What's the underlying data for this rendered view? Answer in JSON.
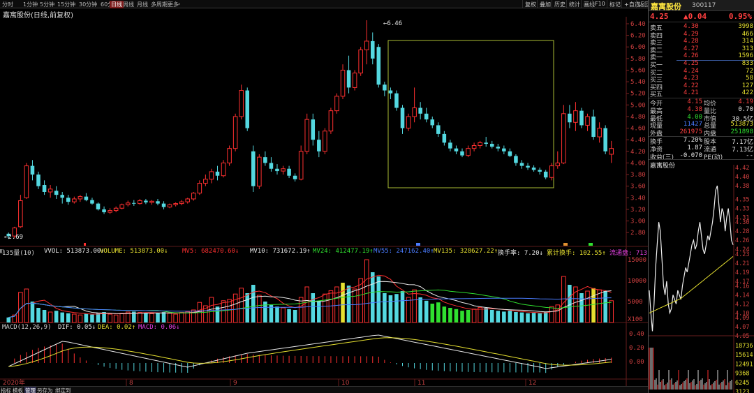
{
  "topbar": {
    "periods": [
      "分时",
      "1分钟",
      "5分钟",
      "15分钟",
      "30分钟",
      "60分钟",
      "日线",
      "周线",
      "月线",
      "多周期",
      "更多"
    ],
    "active_period": "日线",
    "right_tools": [
      "复权",
      "叠加",
      "历史",
      "统计",
      "画线",
      "F10",
      "标记",
      "+自选",
      "返回"
    ]
  },
  "chart": {
    "title": "嘉寓股份(日线,前复权)",
    "high_label": "6.46",
    "low_label": "2.69",
    "price_ticks": [
      "6.40",
      "6.20",
      "6.00",
      "5.80",
      "5.60",
      "5.40",
      "5.20",
      "5.00",
      "4.80",
      "4.60",
      "4.40",
      "4.20",
      "4.00",
      "3.80",
      "3.60",
      "3.40",
      "3.20",
      "3.00",
      "2.80"
    ],
    "month_labels": [
      "2020年",
      "8",
      "9",
      "10",
      "11",
      "12"
    ],
    "vol_header": [
      {
        "text": "135量(10)",
        "color": "#d0d0d0"
      },
      {
        "text": "VVOL: 513873.00↑",
        "color": "#e8e8e8"
      },
      {
        "text": "VOLUME: 513873.00↓",
        "color": "#e6e030"
      },
      {
        "text": "MV5: 682470.60↓",
        "color": "#ff3030"
      },
      {
        "text": "MV10: 731672.19↑",
        "color": "#e8e8e8"
      },
      {
        "text": "MV24: 412477.19↑",
        "color": "#30e030"
      },
      {
        "text": "MV55: 247162.40↑",
        "color": "#4a7cff"
      },
      {
        "text": "MV135: 328627.22↑",
        "color": "#e6e030"
      },
      {
        "text": "换手率: 7.20↓",
        "color": "#e8e8e8"
      },
      {
        "text": "累计换手: 102.55↑",
        "color": "#e6e030"
      },
      {
        "text": "流通盘: 713",
        "color": "#e040e0"
      }
    ],
    "vol_ticks": [
      "15000",
      "10000",
      "5000",
      "X100"
    ],
    "macd_header": [
      {
        "text": "MACD(12,26,9)",
        "color": "#d0d0d0"
      },
      {
        "text": "DIF: 0.05↓",
        "color": "#e8e8e8"
      },
      {
        "text": "DEA: 0.02↑",
        "color": "#e6e030"
      },
      {
        "text": "MACD: 0.06↓",
        "color": "#e040e0"
      }
    ],
    "macd_ticks": [
      "0.40",
      "0.20",
      "0.00"
    ]
  },
  "bottom_tabs": [
    "指标",
    "模板",
    "管理",
    "另存为",
    "绑定到"
  ],
  "quote": {
    "name": "嘉寓股份",
    "code": "300117",
    "price": "4.25",
    "change": "▲0.04",
    "change_pct": "0.95%",
    "asks": [
      {
        "label": "卖五",
        "price": "4.30",
        "vol": "3998"
      },
      {
        "label": "卖四",
        "price": "4.29",
        "vol": "466"
      },
      {
        "label": "卖三",
        "price": "4.28",
        "vol": "314"
      },
      {
        "label": "卖二",
        "price": "4.27",
        "vol": "313"
      },
      {
        "label": "卖一",
        "price": "4.26",
        "vol": "1596"
      }
    ],
    "bids": [
      {
        "label": "买一",
        "price": "4.25",
        "vol": "833"
      },
      {
        "label": "买二",
        "price": "4.24",
        "vol": "72"
      },
      {
        "label": "买三",
        "price": "4.23",
        "vol": "58"
      },
      {
        "label": "买四",
        "price": "4.22",
        "vol": "127"
      },
      {
        "label": "买五",
        "price": "4.21",
        "vol": "422"
      }
    ],
    "stats": [
      {
        "l1": "今开",
        "v1": "4.15",
        "c1": "#ff4040",
        "l2": "均价",
        "v2": "4.19",
        "c2": "#ff4040"
      },
      {
        "l1": "最高",
        "v1": "4.38",
        "c1": "#ff4040",
        "l2": "量比",
        "v2": "0.70",
        "c2": "#e8e8e8"
      },
      {
        "l1": "最低",
        "v1": "4.00",
        "c1": "#30e030",
        "l2": "市值",
        "v2": "30.5亿",
        "c2": "#e8e8e8"
      },
      {
        "l1": "现量",
        "v1": "11427",
        "c1": "#4a7cff",
        "l2": "总量",
        "v2": "513873",
        "c2": "#e6e030"
      },
      {
        "l1": "外盘",
        "v1": "261975",
        "c1": "#ff4040",
        "l2": "内盘",
        "v2": "251898",
        "c2": "#30e030"
      }
    ],
    "stats2": [
      {
        "l1": "换手",
        "v1": "7.20%",
        "l2": "股本",
        "v2": "7.17亿"
      },
      {
        "l1": "净资",
        "v1": "1.87",
        "l2": "流通",
        "v2": "7.13亿"
      },
      {
        "l1": "收益(三)",
        "v1": "-0.070",
        "l2": "PE(动)",
        "v2": "--"
      }
    ]
  },
  "mini": {
    "name": "嘉寓股份",
    "price_ticks": [
      "4.42",
      "4.40",
      "4.38",
      "4.35",
      "4.33",
      "4.31",
      "4.30",
      "4.28",
      "4.26",
      "4.24",
      "4.23",
      "4.21",
      "4.19",
      "4.17",
      "4.16",
      "4.14",
      "4.12",
      "4.10",
      "4.09",
      "4.07",
      "4.05"
    ],
    "vol_ticks": [
      "18736",
      "15614",
      "12491",
      "9368",
      "6245",
      "3123"
    ],
    "left_ticks": [
      "0.40",
      "0.20",
      "0.00"
    ],
    "tab": "日线"
  },
  "colors": {
    "up": "#ff3030",
    "down": "#54d8e0",
    "yellow": "#e6e030",
    "green": "#30e030",
    "blue": "#4a7cff",
    "white": "#e8e8e8",
    "magenta": "#e040e0",
    "box": "#aabb33"
  },
  "icons": [
    "bookmark-flag-icon",
    "menu-chevron-icon"
  ]
}
